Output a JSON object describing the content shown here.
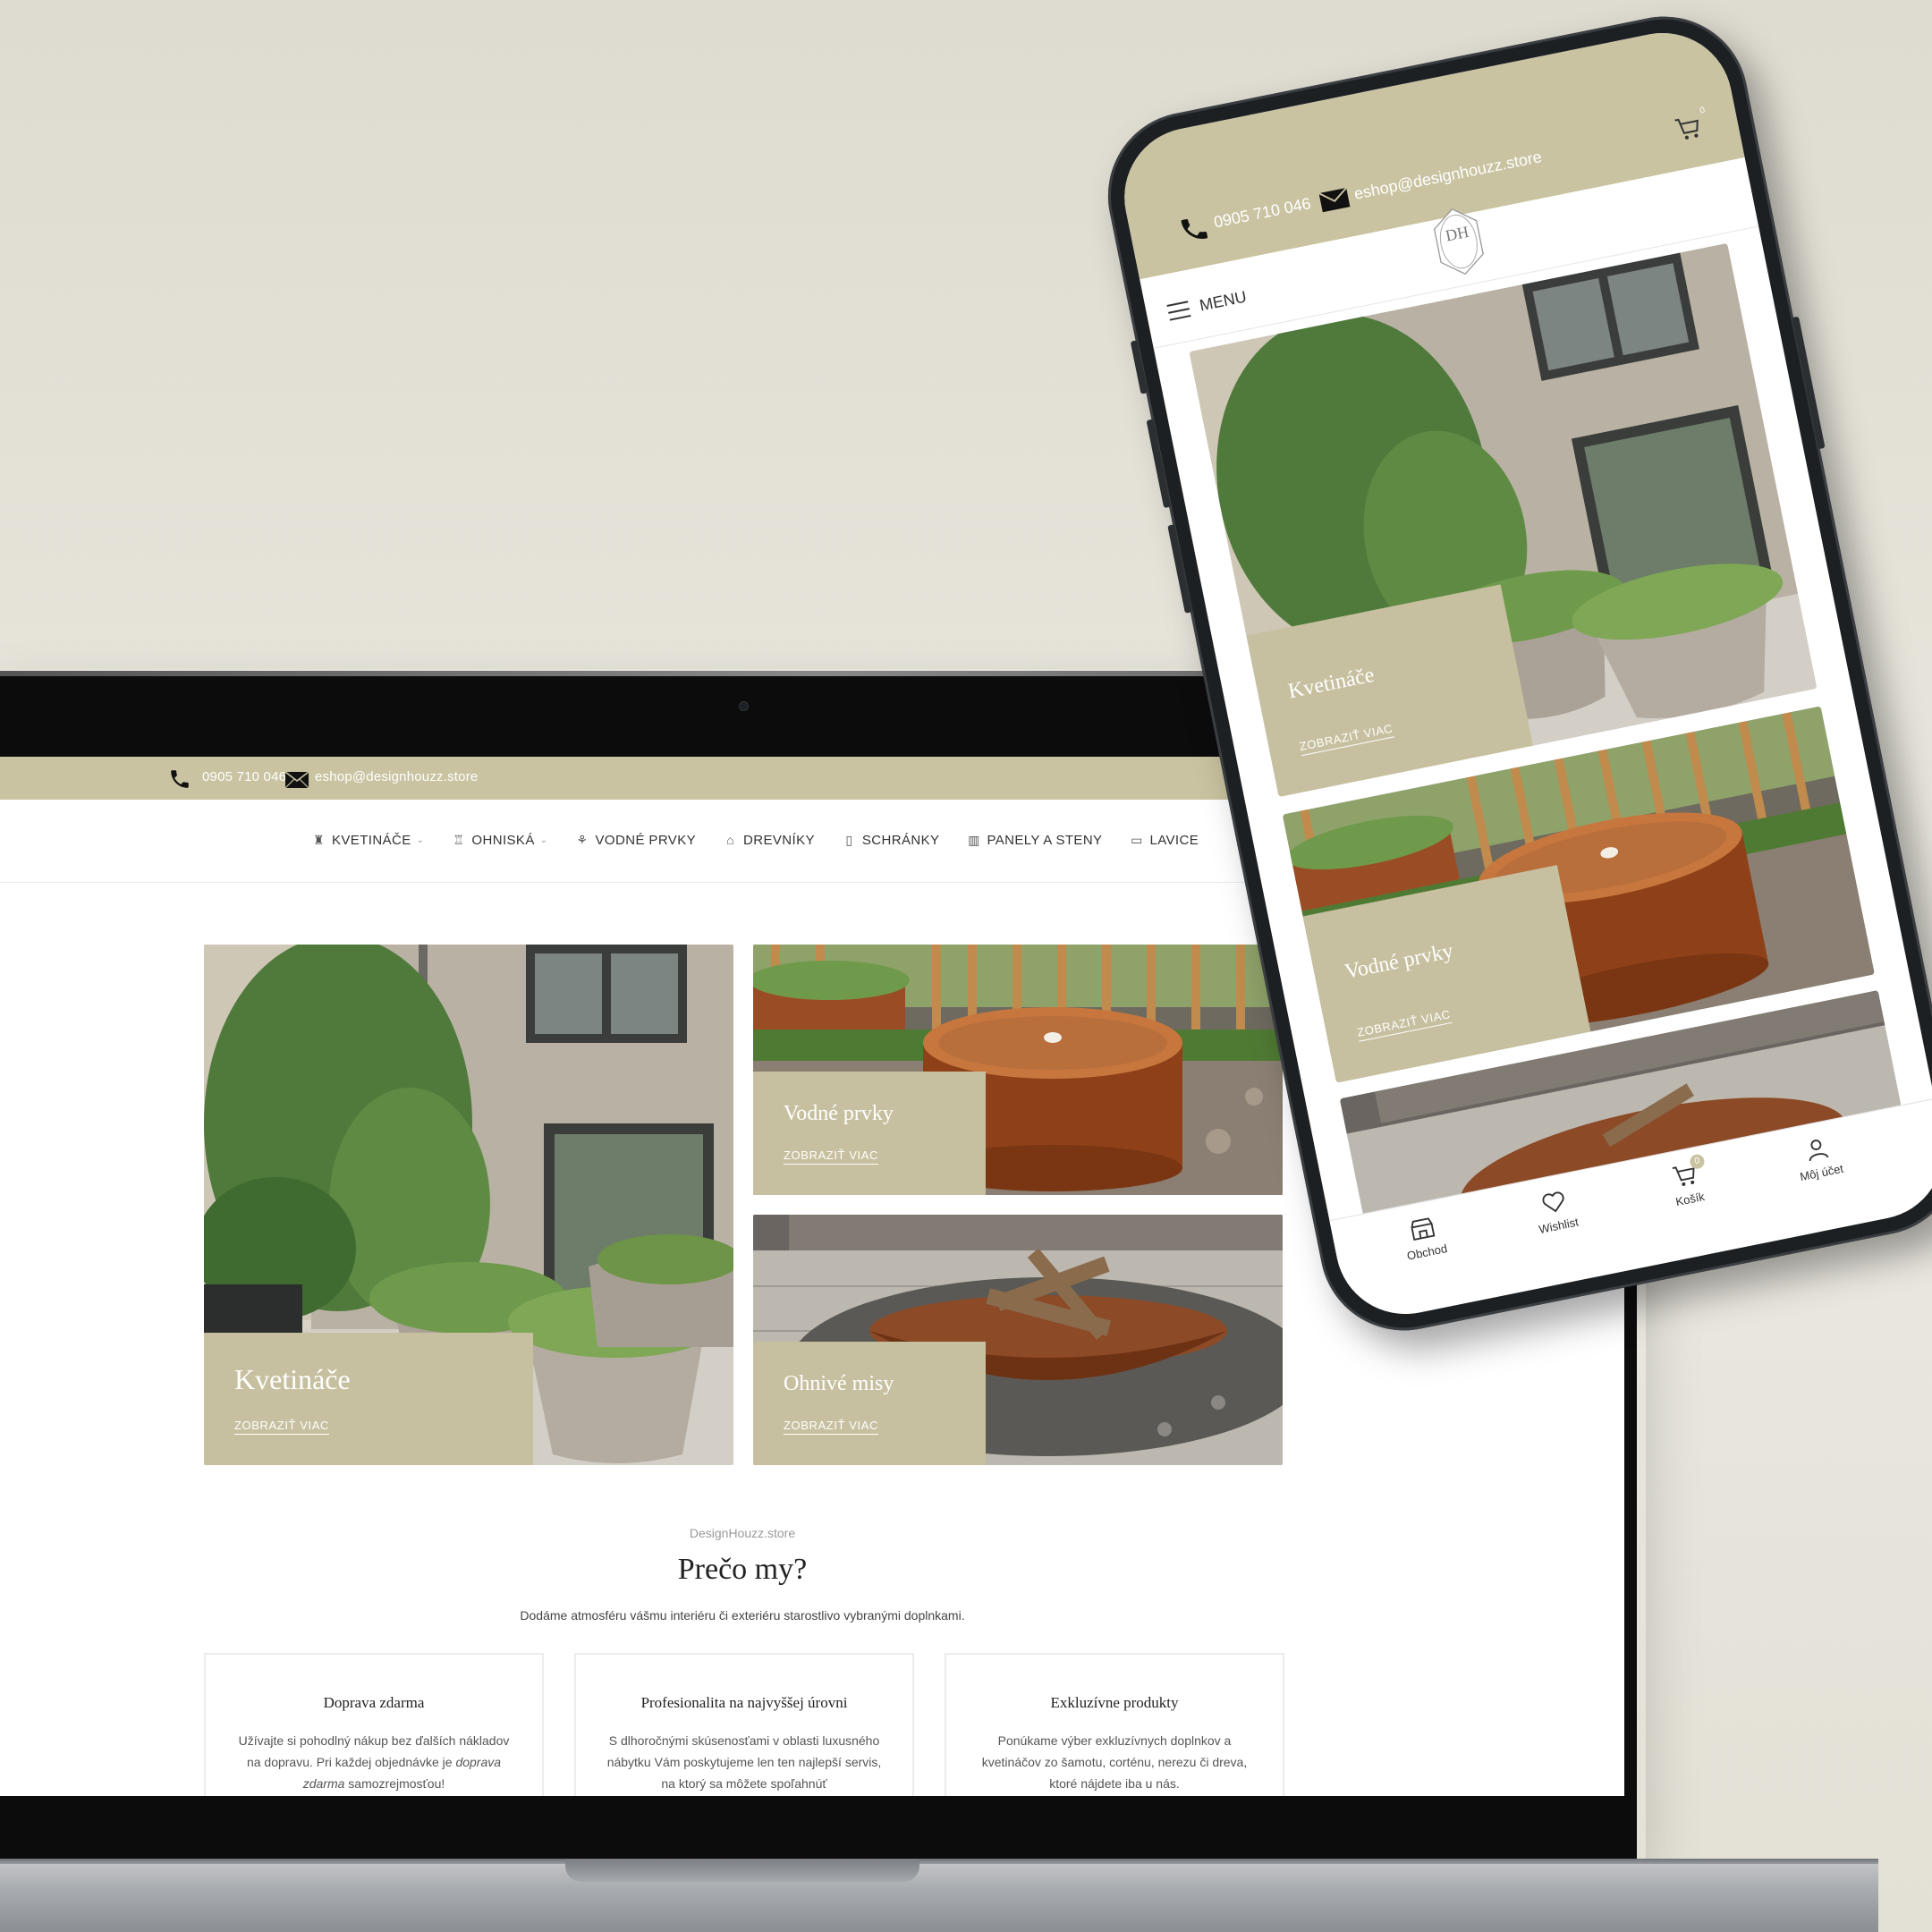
{
  "colors": {
    "accent": "#c9c3a1",
    "caption": "#c7c0a0"
  },
  "desktop": {
    "topbar": {
      "phone": "0905 710 046",
      "email": "eshop@designhouzz.store"
    },
    "nav": [
      {
        "label": "KVETINÁČE",
        "icon": "planter-icon",
        "dropdown": true
      },
      {
        "label": "OHNISKÁ",
        "icon": "firepit-icon",
        "dropdown": true
      },
      {
        "label": "VODNÉ PRVKY",
        "icon": "fountain-icon",
        "dropdown": false
      },
      {
        "label": "DREVNÍKY",
        "icon": "woodstore-icon",
        "dropdown": false
      },
      {
        "label": "SCHRÁNKY",
        "icon": "mailbox-icon",
        "dropdown": false
      },
      {
        "label": "PANELY A STENY",
        "icon": "panel-icon",
        "dropdown": false
      },
      {
        "label": "LAVICE",
        "icon": "bench-icon",
        "dropdown": false
      }
    ],
    "tiles": {
      "large": {
        "title": "Kvetináče",
        "cta": "ZOBRAZIŤ VIAC"
      },
      "water": {
        "title": "Vodné prvky",
        "cta": "ZOBRAZIŤ VIAC"
      },
      "fire": {
        "title": "Ohnivé misy",
        "cta": "ZOBRAZIŤ VIAC"
      }
    },
    "why": {
      "kicker": "DesignHouzz.store",
      "title": "Prečo my?",
      "subtitle": "Dodáme atmosféru vášmu interiéru či exteriéru starostlivo vybranými doplnkami.",
      "cards": [
        {
          "title": "Doprava zdarma",
          "text_a": "Užívajte si pohodlný nákup bez ďalších nákladov na dopravu. Pri každej objednávke je ",
          "text_em": "doprava zdarma",
          "text_b": " samozrejmosťou!"
        },
        {
          "title": "Profesionalita na najvyššej úrovni",
          "text": "S dlhoročnými skúsenosťami v oblasti luxusného nábytku Vám poskytujeme len ten najlepší servis, na ktorý sa môžete spoľahnúť"
        },
        {
          "title": "Exkluzívne produkty",
          "text": "Ponúkame výber exkluzívnych doplnkov a kvetináčov zo šamotu, corténu, nerezu či dreva, ktoré nájdete iba u nás."
        }
      ]
    }
  },
  "mobile": {
    "topbar": {
      "phone": "0905 710 046",
      "email": "eshop@designhouzz.store",
      "cart_count": "0"
    },
    "logo": "DH",
    "menu_label": "MENU",
    "tiles": [
      {
        "title": "Kvetináče",
        "cta": "ZOBRAZIŤ VIAC"
      },
      {
        "title": "Vodné prvky",
        "cta": "ZOBRAZIŤ VIAC"
      }
    ],
    "bottom_nav": [
      {
        "label": "Obchod",
        "icon": "shop-icon"
      },
      {
        "label": "Wishlist",
        "icon": "heart-icon"
      },
      {
        "label": "Košík",
        "icon": "cart-icon",
        "badge": "0"
      },
      {
        "label": "Môj účet",
        "icon": "user-icon"
      }
    ]
  }
}
